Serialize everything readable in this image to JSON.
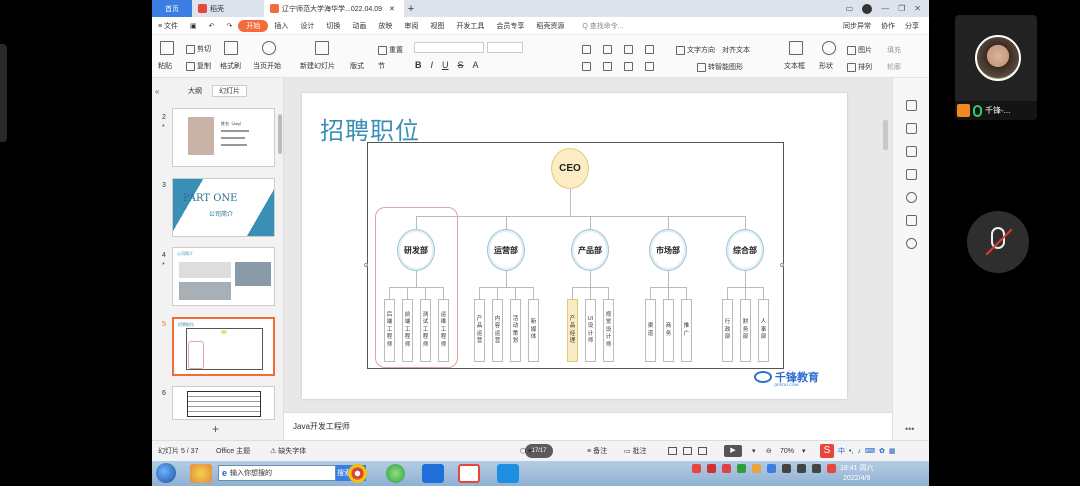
{
  "tabs": {
    "home": "首页",
    "store": "稻壳",
    "doc": "辽宁师范大学海华学...022.04.09",
    "plus": "+"
  },
  "menu": {
    "file": "≡ 文件",
    "items": [
      "开始",
      "插入",
      "设计",
      "切换",
      "动画",
      "放映",
      "审阅",
      "视图",
      "开发工具",
      "会员专享",
      "稻壳资源"
    ],
    "search": "Q 查找命令...",
    "sync": "同步异常",
    "collab": "协作",
    "share": "分享"
  },
  "ribbon": {
    "paste": "粘贴",
    "cut": "剪切",
    "copy": "复制",
    "format_painter": "格式刷",
    "play_from": "当页开始",
    "new_slide": "新建幻灯片",
    "layout": "版式",
    "section": "节",
    "reset": "重置",
    "text_direction": "文字方向",
    "align_text": "对齐文本",
    "convert_smartart": "转智能图形",
    "textbox": "文本框",
    "shape": "形状",
    "arrange": "排列",
    "picture": "图片",
    "fill": "填充",
    "outline": "轮廓"
  },
  "left_pane": {
    "tab_outline": "大纲",
    "tab_slides": "幻灯片",
    "collapse": "«",
    "add": "+",
    "thumbs": [
      {
        "num": "2",
        "star": "*",
        "lines": [
          "姓名（Aby）",
          "",
          "",
          ""
        ]
      },
      {
        "num": "3",
        "star": "",
        "title": "PART ONE",
        "subtitle": "公司简介"
      },
      {
        "num": "4",
        "star": "*",
        "heading": "公司简介"
      },
      {
        "num": "5",
        "star": "",
        "heading": "招聘职位"
      },
      {
        "num": "6",
        "star": "",
        "heading": ""
      }
    ]
  },
  "slide": {
    "title": "招聘职位",
    "ceo": "CEO",
    "departments": [
      {
        "name": "研发部",
        "roles": [
          "后端工程师",
          "前端工程师",
          "测试工程师",
          "运维工程师"
        ]
      },
      {
        "name": "运营部",
        "roles": [
          "产品运营",
          "内容运营",
          "活动策划",
          "新媒体"
        ]
      },
      {
        "name": "产品部",
        "roles": [
          "产品经理",
          "UI设计师",
          "视觉设计师"
        ]
      },
      {
        "name": "市场部",
        "roles": [
          "渠道",
          "商务",
          "推广"
        ]
      },
      {
        "name": "综合部",
        "roles": [
          "行政部",
          "财务部",
          "人事部"
        ]
      }
    ],
    "logo_text": "千锋教育",
    "logo_url": "QFEDU.COM"
  },
  "notes": {
    "text": "Java开发工程师"
  },
  "status": {
    "slide_count": "幻灯片 5 / 37",
    "theme": "Office 主题",
    "missing_font": "缺失字体",
    "page_pill": "17/17",
    "notes": "备注",
    "comments": "批注",
    "zoom": "70%"
  },
  "taskbar": {
    "search_placeholder": "输入你想搜的",
    "search_btn": "搜索一下",
    "time": "18:41 周六",
    "date": "2022/4/9"
  },
  "video": {
    "label": "千锋-..."
  },
  "colors": {
    "accent": "#f36b3b",
    "title": "#3a8fb7",
    "ceo_fill": "#fbecc4",
    "highlight": "#f8eac3",
    "taskbar": "#8fb0d3"
  }
}
